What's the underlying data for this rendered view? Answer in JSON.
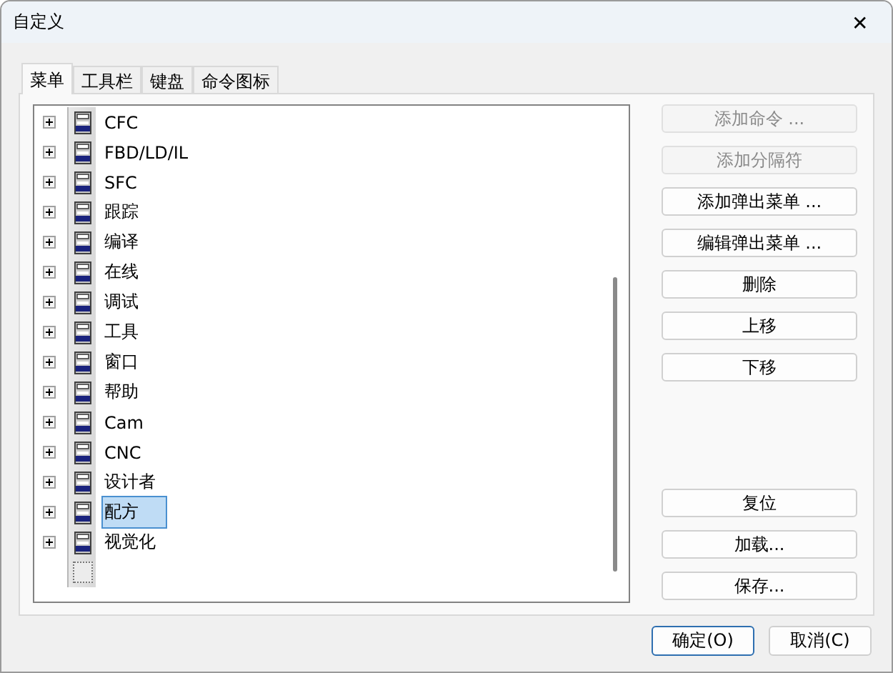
{
  "window": {
    "title": "自定义",
    "close": "✕"
  },
  "tabs": [
    {
      "label": "菜单",
      "selected": true
    },
    {
      "label": "工具栏",
      "selected": false
    },
    {
      "label": "键盘",
      "selected": false
    },
    {
      "label": "命令图标",
      "selected": false
    }
  ],
  "tree": {
    "items": [
      {
        "label": "CFC",
        "selected": false
      },
      {
        "label": "FBD/LD/IL",
        "selected": false
      },
      {
        "label": "SFC",
        "selected": false
      },
      {
        "label": "跟踪",
        "selected": false
      },
      {
        "label": "编译",
        "selected": false
      },
      {
        "label": "在线",
        "selected": false
      },
      {
        "label": "调试",
        "selected": false
      },
      {
        "label": "工具",
        "selected": false
      },
      {
        "label": "窗口",
        "selected": false
      },
      {
        "label": "帮助",
        "selected": false
      },
      {
        "label": "Cam",
        "selected": false
      },
      {
        "label": "CNC",
        "selected": false
      },
      {
        "label": "设计者",
        "selected": false
      },
      {
        "label": "配方",
        "selected": true
      },
      {
        "label": "视觉化",
        "selected": false
      }
    ]
  },
  "side_buttons": [
    {
      "label": "添加命令 ...",
      "disabled": true
    },
    {
      "label": "添加分隔符",
      "disabled": true
    },
    {
      "label": "添加弹出菜单 ...",
      "disabled": false
    },
    {
      "label": "编辑弹出菜单 ...",
      "disabled": false
    },
    {
      "label": "删除",
      "disabled": false
    },
    {
      "label": "上移",
      "disabled": false
    },
    {
      "label": "下移",
      "disabled": false
    }
  ],
  "lower_buttons": [
    {
      "label": "复位",
      "disabled": false
    },
    {
      "label": "加载...",
      "disabled": false
    },
    {
      "label": "保存...",
      "disabled": false
    }
  ],
  "footer_buttons": [
    {
      "label": "确定(O)",
      "default": true
    },
    {
      "label": "取消(C)",
      "default": false
    }
  ]
}
